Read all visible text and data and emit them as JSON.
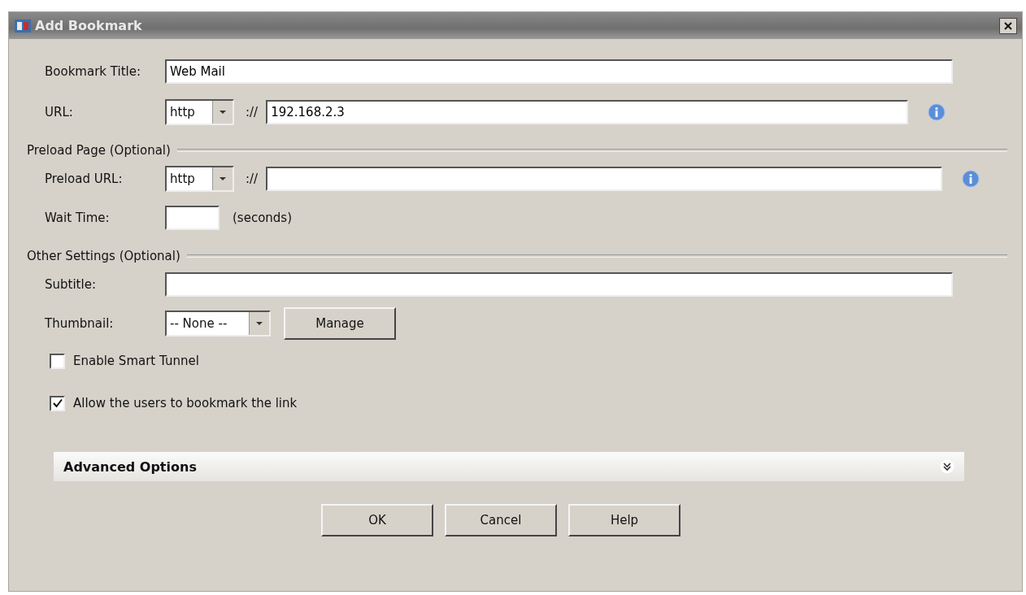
{
  "window": {
    "title": "Add Bookmark"
  },
  "bookmark_title": {
    "label": "Bookmark Title:",
    "value": "Web Mail"
  },
  "url": {
    "label": "URL:",
    "protocol": "http",
    "separator": "://",
    "value": "192.168.2.3"
  },
  "preload_section": {
    "title": "Preload Page (Optional)",
    "preload_url": {
      "label": "Preload URL:",
      "protocol": "http",
      "separator": "://"
    },
    "wait_time": {
      "label": "Wait Time:",
      "unit": "(seconds)"
    }
  },
  "other_section": {
    "title": "Other Settings (Optional)",
    "subtitle": {
      "label": "Subtitle:"
    },
    "thumbnail": {
      "label": "Thumbnail:",
      "value": "-- None --",
      "button": "Manage"
    },
    "checkboxes": [
      {
        "label": "Enable Smart Tunnel",
        "checked": false
      },
      {
        "label": "Allow the users to bookmark the link",
        "checked": true
      }
    ]
  },
  "advanced_options": {
    "title": "Advanced Options",
    "expanded": false
  },
  "buttons": [
    "OK",
    "Cancel",
    "Help"
  ]
}
